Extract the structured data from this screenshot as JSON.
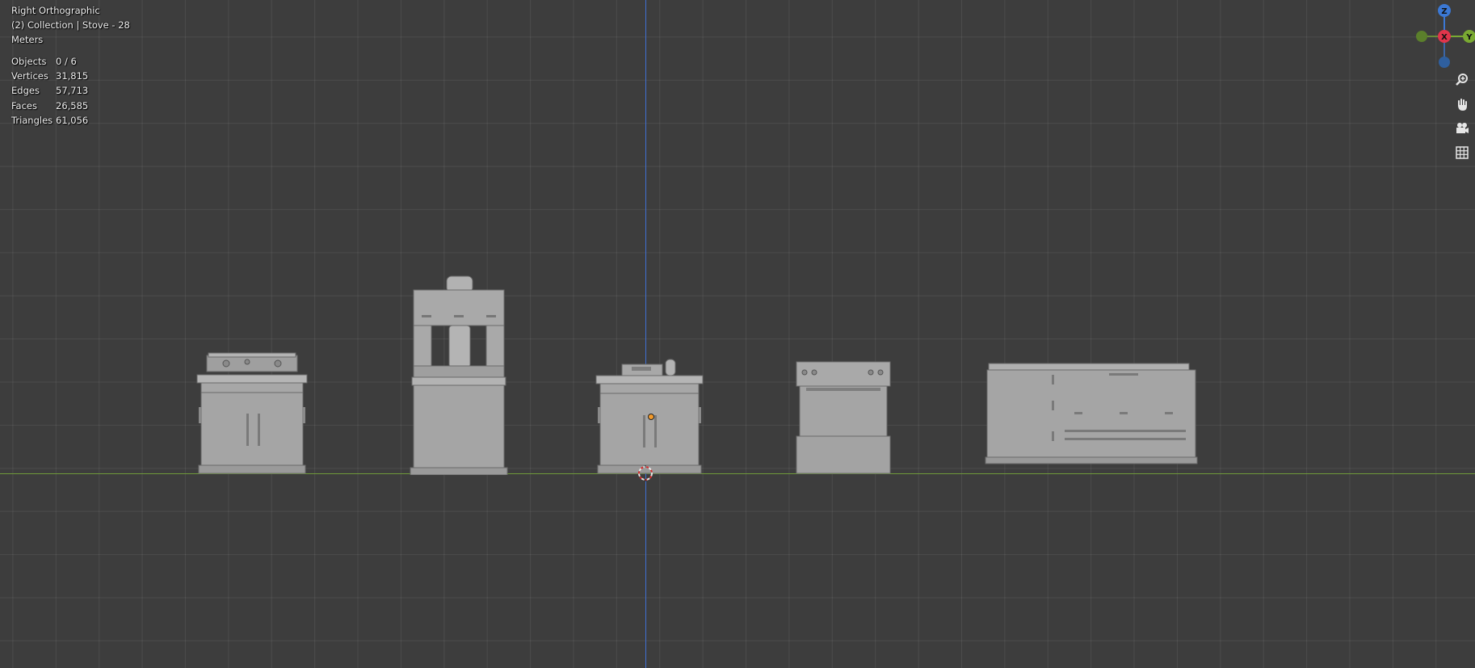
{
  "viewport": {
    "view_name": "Right Orthographic",
    "collection_info": "(2) Collection | Stove - 28",
    "units": "Meters"
  },
  "stats": [
    {
      "label": "Objects",
      "value": "0 / 6"
    },
    {
      "label": "Vertices",
      "value": "31,815"
    },
    {
      "label": "Edges",
      "value": "57,713"
    },
    {
      "label": "Faces",
      "value": "26,585"
    },
    {
      "label": "Triangles",
      "value": "61,056"
    }
  ],
  "gizmo": {
    "z_label": "Z",
    "x_label": "X",
    "y_label": "Y",
    "colors": {
      "z": "#3b78d4",
      "x": "#e0354b",
      "y": "#7aaa32"
    }
  },
  "nav_icons": [
    "zoom-icon",
    "pan-hand-icon",
    "camera-icon",
    "grid-perspective-icon"
  ],
  "colors": {
    "background": "#3d3d3d",
    "model_gray": "#a5a5a5",
    "x_axis": "#6f9a3a",
    "z_axis": "#3f6fd4"
  }
}
